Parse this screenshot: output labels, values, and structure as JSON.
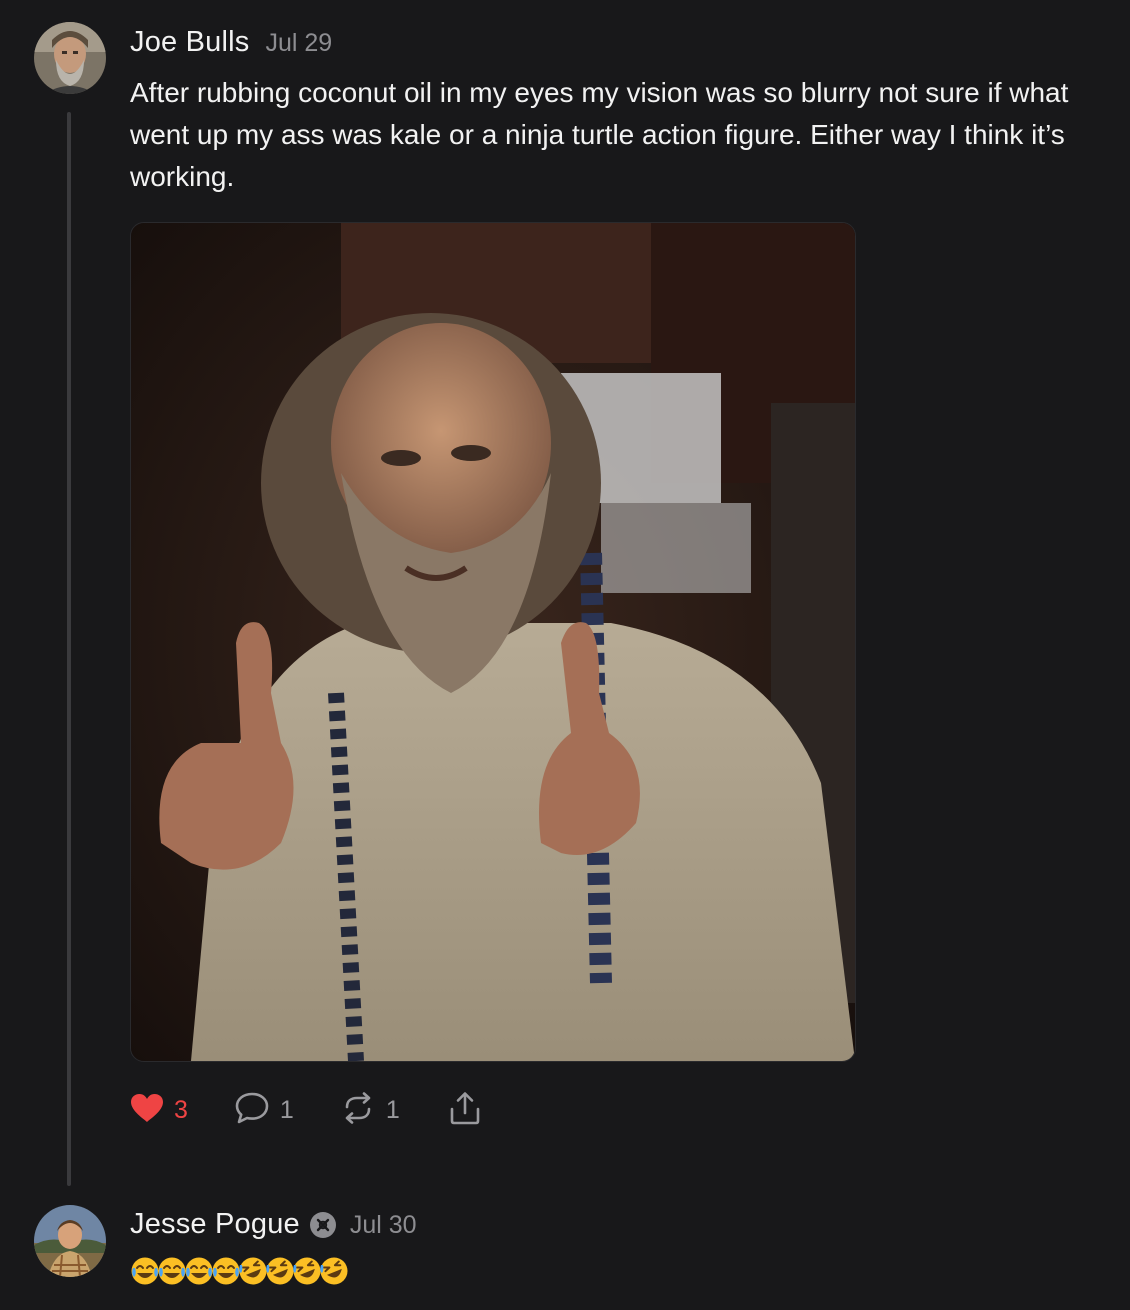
{
  "posts": [
    {
      "author": "Joe Bulls",
      "date": "Jul 29",
      "text": "After rubbing coconut oil in my eyes my vision was so blurry not sure if what went up my ass was kale or a ninja turtle action figure. Either way I think it’s working.",
      "actions": {
        "likes": "3",
        "comments": "1",
        "reposts": "1"
      }
    },
    {
      "author": "Jesse Pogue",
      "date": "Jul 30",
      "emojis": [
        "😂",
        "😂",
        "😂",
        "😂",
        "🤣",
        "🤣",
        "🤣",
        "🤣"
      ]
    }
  ],
  "colors": {
    "background": "#18181a",
    "like": "#ef4444",
    "muted": "#8d8d91",
    "text": "#f2f2f2"
  },
  "icons": [
    "heart-icon",
    "comment-icon",
    "repost-icon",
    "share-icon",
    "verified-badge-icon"
  ]
}
